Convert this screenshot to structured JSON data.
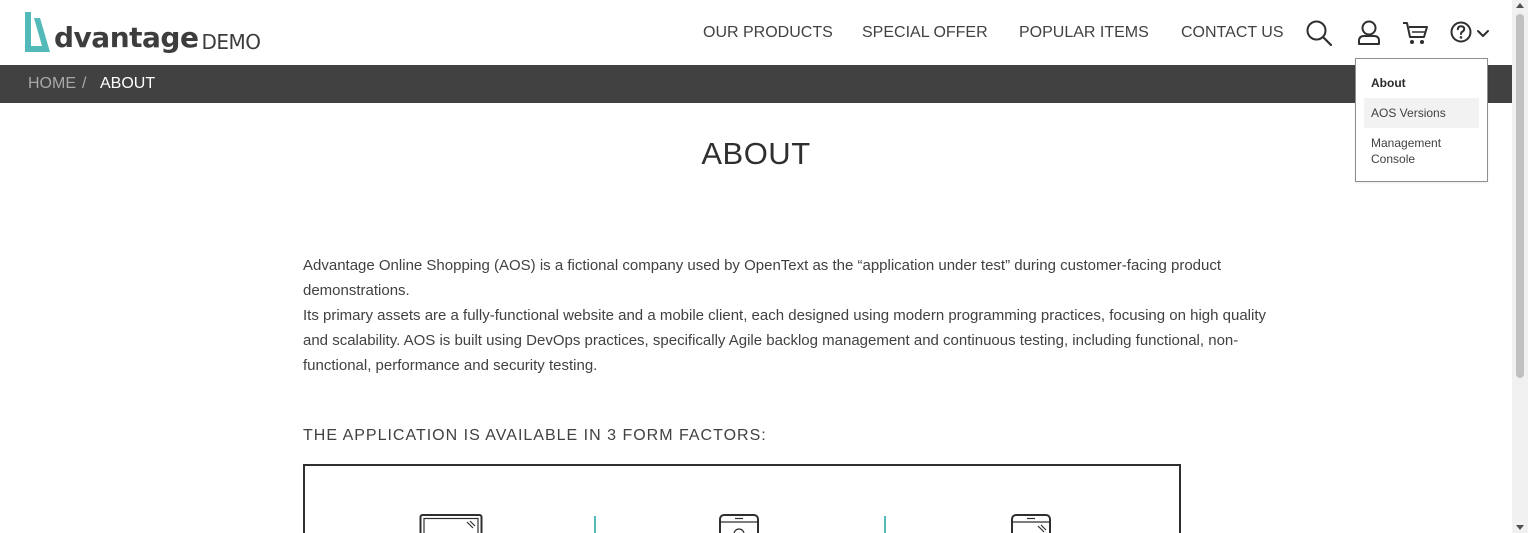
{
  "brand": {
    "logo_letter": "A",
    "name_bold": "dvantage",
    "name_light": "DEMO",
    "accent_color": "#54b9b9"
  },
  "nav": {
    "items": [
      {
        "label": "OUR PRODUCTS"
      },
      {
        "label": "SPECIAL OFFER"
      },
      {
        "label": "POPULAR ITEMS"
      },
      {
        "label": "CONTACT US"
      }
    ],
    "icons": [
      "search-icon",
      "user-icon",
      "cart-icon",
      "help-icon",
      "chevron-down-icon"
    ]
  },
  "breadcrumb": {
    "home": "HOME",
    "separator": "/",
    "current": "ABOUT"
  },
  "help_menu": {
    "items": [
      {
        "label": "About"
      },
      {
        "label": "AOS Versions"
      },
      {
        "label": "Management Console"
      }
    ]
  },
  "main": {
    "title": "ABOUT",
    "intro_p1": "Advantage Online Shopping (AOS) is a fictional company used by OpenText as the “application under test” during customer-facing product demonstrations.",
    "intro_p2": "Its primary assets are a fully-functional website and a mobile client, each designed using modern programming practices, focusing on high quality and scalability.  AOS is built using DevOps practices, specifically Agile backlog management and continuous testing, including functional, non-functional, performance and security testing.",
    "form_factors_heading": "THE APPLICATION IS AVAILABLE IN 3 FORM FACTORS:",
    "form_factor_icons": [
      "desktop-icon",
      "tablet-icon",
      "mobile-icon"
    ]
  }
}
